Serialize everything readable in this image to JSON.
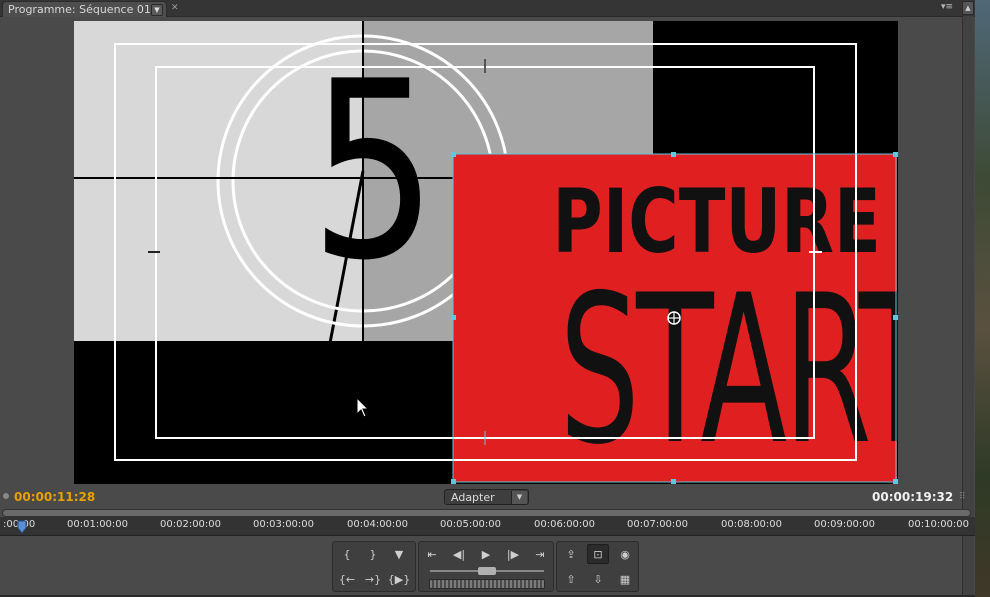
{
  "panel": {
    "tab_label": "Programme: Séquence 01",
    "tab_dropdown_icon": "chevron-down-icon",
    "close_icon": "close-icon",
    "menu_icon": "panel-menu-icon"
  },
  "monitor": {
    "countdown_number": "5",
    "card": {
      "line1": "PICTURE",
      "line2": "START",
      "background": "#e02020"
    },
    "quadrant_colors": {
      "light": "#d8d8d8",
      "mid": "#a6a6a6",
      "dark": "#000000"
    },
    "selection_handle_color": "#5ec8dc"
  },
  "time": {
    "current": "00:00:11:28",
    "duration": "00:00:19:32",
    "current_color": "#e8a200",
    "zoom": "Adapter"
  },
  "ruler": {
    "labels": [
      ":00:00",
      "00:01:00:00",
      "00:02:00:00",
      "00:03:00:00",
      "00:04:00:00",
      "00:05:00:00",
      "00:06:00:00",
      "00:07:00:00",
      "00:08:00:00",
      "00:09:00:00",
      "00:10:00:00"
    ]
  },
  "transport": {
    "buttons": [
      {
        "name": "mark-in-button",
        "icon": "mark-in-icon",
        "glyph": "{"
      },
      {
        "name": "mark-out-button",
        "icon": "mark-out-icon",
        "glyph": "}"
      },
      {
        "name": "add-marker-button",
        "icon": "marker-icon",
        "glyph": "▼"
      },
      {
        "name": "go-to-in-button",
        "icon": "go-to-in-icon",
        "glyph": "{←"
      },
      {
        "name": "go-to-out-button",
        "icon": "go-to-out-icon",
        "glyph": "→}"
      },
      {
        "name": "play-in-to-out-button",
        "icon": "play-in-out-icon",
        "glyph": "{▶}"
      },
      {
        "name": "go-to-previous-edit-button",
        "icon": "previous-edit-icon",
        "glyph": "⇤"
      },
      {
        "name": "step-back-button",
        "icon": "step-back-icon",
        "glyph": "◀|"
      },
      {
        "name": "play-button",
        "icon": "play-icon",
        "glyph": "▶"
      },
      {
        "name": "step-forward-button",
        "icon": "step-forward-icon",
        "glyph": "|▶"
      },
      {
        "name": "go-to-next-edit-button",
        "icon": "next-edit-icon",
        "glyph": "⇥"
      },
      {
        "name": "export-frame-button",
        "icon": "export-icon",
        "glyph": "⇪"
      },
      {
        "name": "safe-margins-button",
        "icon": "safe-margins-icon",
        "glyph": "⊡"
      },
      {
        "name": "output-button",
        "icon": "output-icon",
        "glyph": "◉"
      },
      {
        "name": "lift-button",
        "icon": "lift-icon",
        "glyph": "⇧"
      },
      {
        "name": "extract-button",
        "icon": "extract-icon",
        "glyph": "⇩"
      },
      {
        "name": "trim-button",
        "icon": "trim-icon",
        "glyph": "▦"
      }
    ]
  }
}
